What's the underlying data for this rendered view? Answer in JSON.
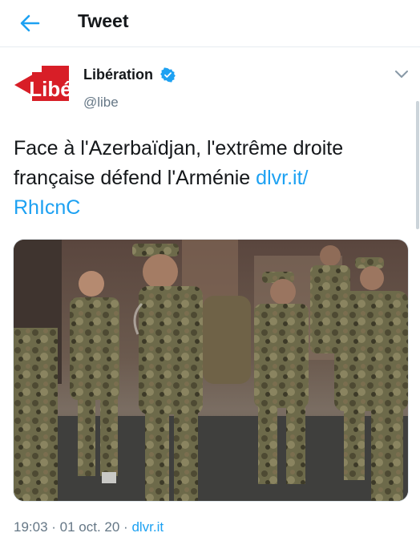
{
  "header": {
    "title": "Tweet"
  },
  "account": {
    "display_name": "Libération",
    "handle": "@libe",
    "logo_text": "Libé"
  },
  "tweet": {
    "text_line1": "Face à l'Azerbaïdjan, l'extrême droite",
    "text_line2_prefix": "française défend l'Arménie ",
    "link_part1": "dlvr.it/",
    "link_part2": "RhIcnC"
  },
  "meta": {
    "time": "19:03",
    "sep1": " · ",
    "date": "01 oct. 20",
    "sep2": " · ",
    "source": "dlvr.it"
  },
  "colors": {
    "accent": "#1da1f2",
    "muted": "#657786",
    "logo_red": "#d81e27"
  },
  "icons": {
    "back": "arrow-left-icon",
    "verified": "verified-badge-icon",
    "more": "chevron-down-icon"
  }
}
